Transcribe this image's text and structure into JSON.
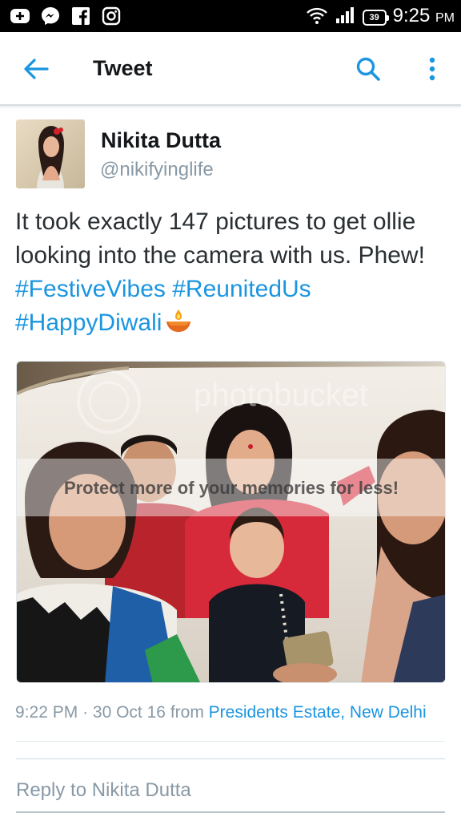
{
  "status_bar": {
    "time": "9:25",
    "ampm": "PM",
    "battery": "39",
    "notification_icons": [
      "add-icon",
      "messenger-icon",
      "facebook-icon",
      "instagram-icon"
    ]
  },
  "app_bar": {
    "title": "Tweet",
    "back_icon": "arrow-left-icon",
    "search_icon": "search-icon",
    "more_icon": "more-vertical-icon"
  },
  "tweet": {
    "author_name": "Nikita Dutta",
    "author_handle": "@nikifyinglife",
    "text_plain": "It took exactly 147 pictures to get ollie looking into the camera with us. Phew!",
    "hashtags": [
      "#FestiveVibes",
      "#ReunitedUs",
      "#HappyDiwali"
    ],
    "emoji": "diya-lamp-icon",
    "photo_watermark": "Protect more of your memories for less!",
    "photo_brand": "photobucket",
    "time": "9:22 PM",
    "separator": "·",
    "date": "30 Oct 16",
    "from_label": "from",
    "location": "Presidents Estate, New Delhi"
  },
  "reply": {
    "placeholder": "Reply to Nikita Dutta"
  },
  "colors": {
    "accent": "#1b95e0",
    "text": "#292f33",
    "muted": "#8899a6"
  }
}
